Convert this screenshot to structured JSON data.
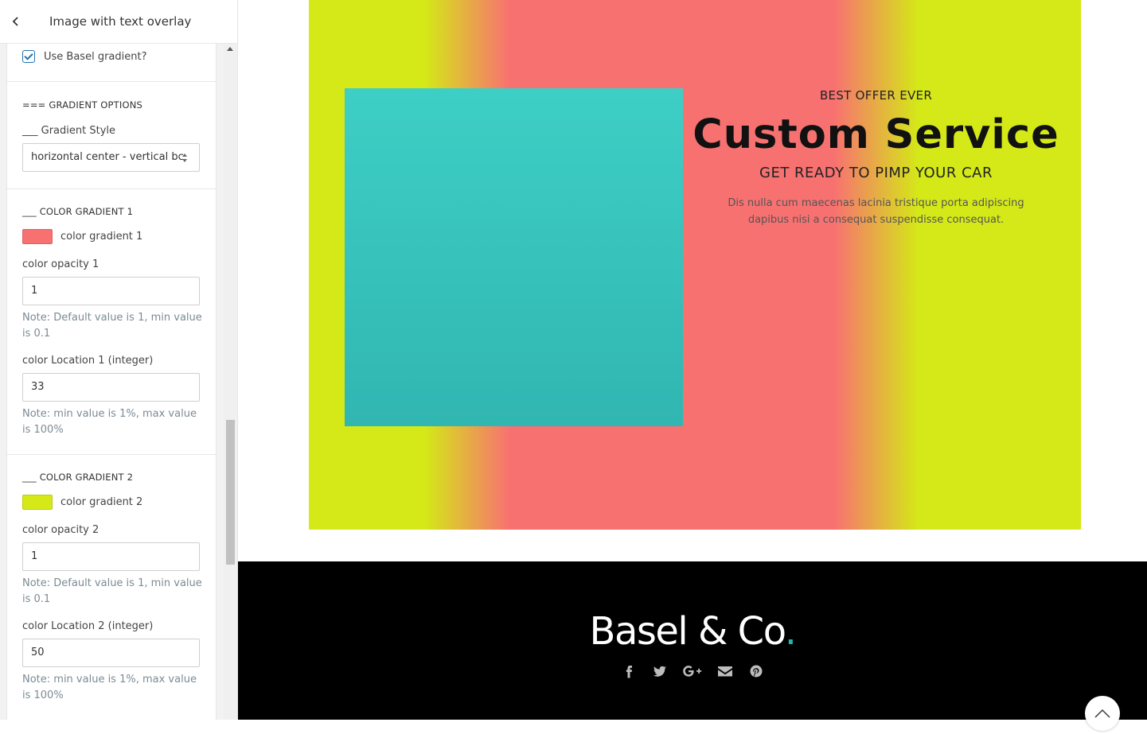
{
  "header": {
    "title": "Image with text overlay"
  },
  "sidebar": {
    "use_gradient_label": "Use Basel gradient?",
    "use_gradient_checked": true,
    "gradient_section_title": "=== GRADIENT OPTIONS",
    "gradient_style_label": "___ Gradient Style",
    "gradient_style_value": "horizontal center - vertical bc",
    "color1_section": "___ COLOR GRADIENT 1",
    "color1_label": "color gradient 1",
    "color1_hex": "#f87171",
    "opacity1_label": "color opacity 1",
    "opacity1_value": "1",
    "opacity1_note": "Note: Default value is 1, min value is 0.1",
    "location1_label": "color Location 1 (integer)",
    "location1_value": "33",
    "location1_note": "Note: min value is 1%, max value is 100%",
    "color2_section": "___ COLOR GRADIENT 2",
    "color2_label": "color gradient 2",
    "color2_hex": "#d4e917",
    "opacity2_label": "color opacity 2",
    "opacity2_value": "1",
    "opacity2_note": "Note: Default value is 1, min value is 0.1",
    "location2_label": "color Location 2 (integer)",
    "location2_value": "50",
    "location2_note": "Note: min value is 1%, max value is 100%"
  },
  "preview": {
    "offer": "BEST OFFER EVER",
    "headline": "Custom Service",
    "subhead": "GET READY TO PIMP YOUR CAR",
    "description": "Dis nulla cum maecenas lacinia tristique porta adipiscing dapibus nisi a consequat suspendisse consequat.",
    "image_color": "#38c4bd",
    "footer": {
      "logo": "Basel & Co",
      "logo_dot": ".",
      "accent": "#1fb6ad",
      "social_icons": [
        "facebook-icon",
        "twitter-icon",
        "google-plus-icon",
        "email-icon",
        "pinterest-icon"
      ]
    }
  }
}
